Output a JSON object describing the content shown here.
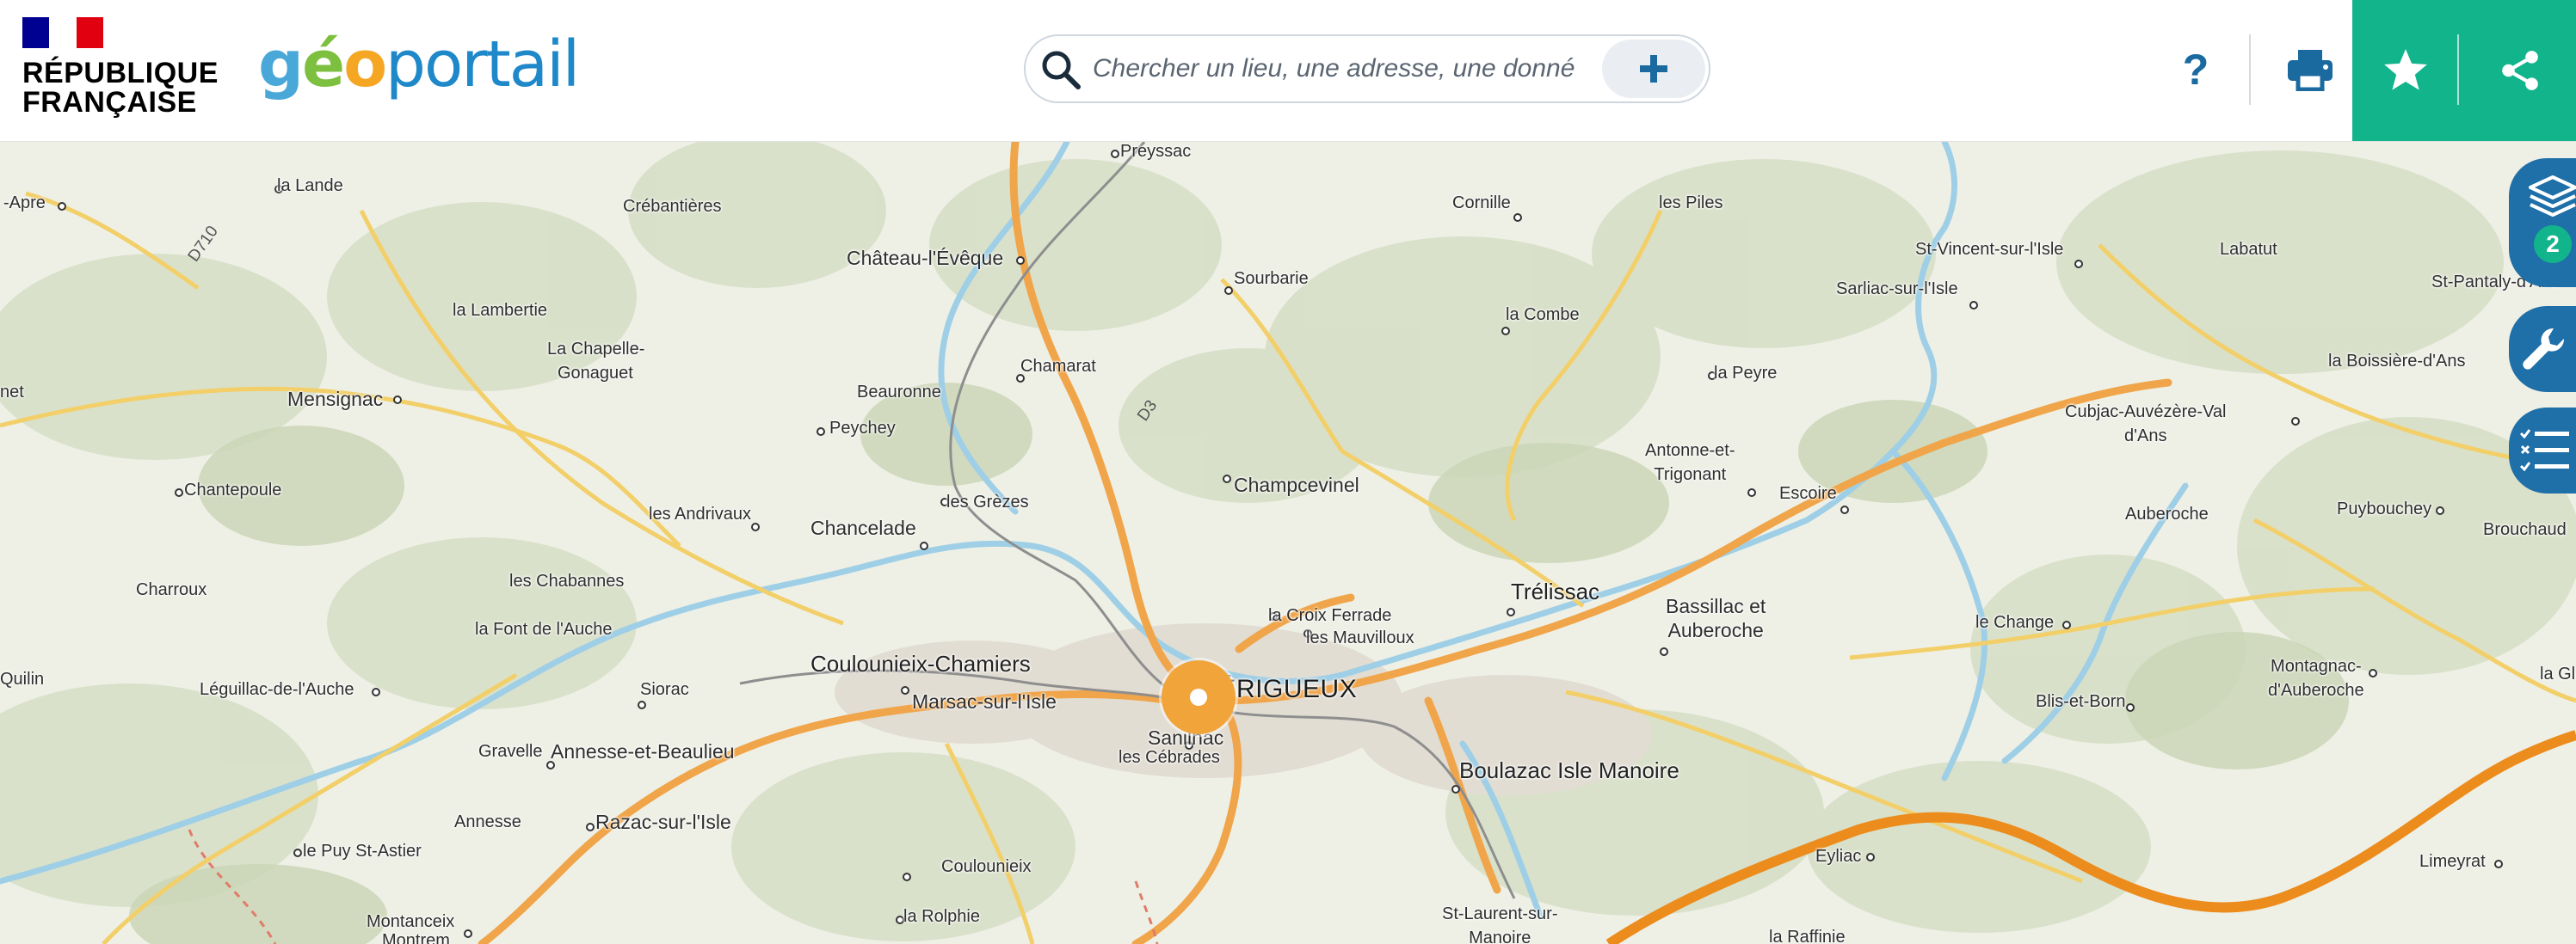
{
  "header": {
    "republique": [
      "RÉPUBLIQUE",
      "FRANÇAISE"
    ],
    "logo": {
      "g": "g",
      "e": "é",
      "o": "o",
      "rest": "portail"
    },
    "search_placeholder": "Chercher un lieu, une adresse, une donnée",
    "help_label": "?",
    "colors": {
      "accent": "#12b48c",
      "brand_blue": "#1f6fa8",
      "flag_blue": "#000091",
      "flag_red": "#e1000f"
    },
    "icons": {
      "search": "search-icon",
      "add": "plus-icon",
      "print": "printer-icon",
      "favorite": "star-icon",
      "share": "share-icon"
    }
  },
  "sidebar": {
    "layers_count": "2",
    "icons": [
      "layers-icon",
      "wrench-icon",
      "legend-list-icon"
    ]
  },
  "map": {
    "places": [
      "-Apre",
      "la Lande",
      "Crébantières",
      "Preyssac",
      "Cornille",
      "les Piles",
      "St-Vincent-sur-l'Isle",
      "Labatut",
      "Château-l'Évêque",
      "Sourbarie",
      "Sarliac-sur-l'Isle",
      "St-Pantaly-d'Ans",
      "la Lambertie",
      "la Combe",
      "La Chapelle-",
      "Gonaguet",
      "Chamarat",
      "la Boissière-d'Ans",
      "la Peyre",
      "Mensignac",
      "Beauronne",
      "Cubjac-Auvézère-Val",
      "d'Ans",
      "net",
      "Peychey",
      "Antonne-et-",
      "Trigonant",
      "Chantepoule",
      "Champcevinel",
      "Escoire",
      "Auberoche",
      "Puybouchey",
      "Brouchaud",
      "les Grèzes",
      "les Andrivaux",
      "Chancelade",
      "les Chabannes",
      "Charroux",
      "Trélissac",
      "la Croix Ferrade",
      "les Mauvilloux",
      "la Font de l'Auche",
      "Bassillac et",
      "Auberoche",
      "le Change",
      "Montagnac-",
      "d'Auberoche",
      "Coulounieix-Chamiers",
      "Siorac",
      "Quilin",
      "Léguillac-de-l'Auche",
      "Marsac-sur-l'Isle",
      "PÉRIGUEUX",
      "Blis-et-Born",
      "Sanilhac",
      "les Cébrades",
      "Gravelle",
      "Annesse-et-Beaulieu",
      "Boulazac Isle Manoire",
      "Annesse",
      "Razac-sur-l'Isle",
      "le Puy St-Astier",
      "Eyliac",
      "Limeyrat",
      "Coulounieix",
      "la Rolphie",
      "Montanceix",
      "Montrem",
      "St-Laurent-sur-",
      "Manoire",
      "la Raffinie",
      "la Gla",
      "D710",
      "D3"
    ]
  }
}
